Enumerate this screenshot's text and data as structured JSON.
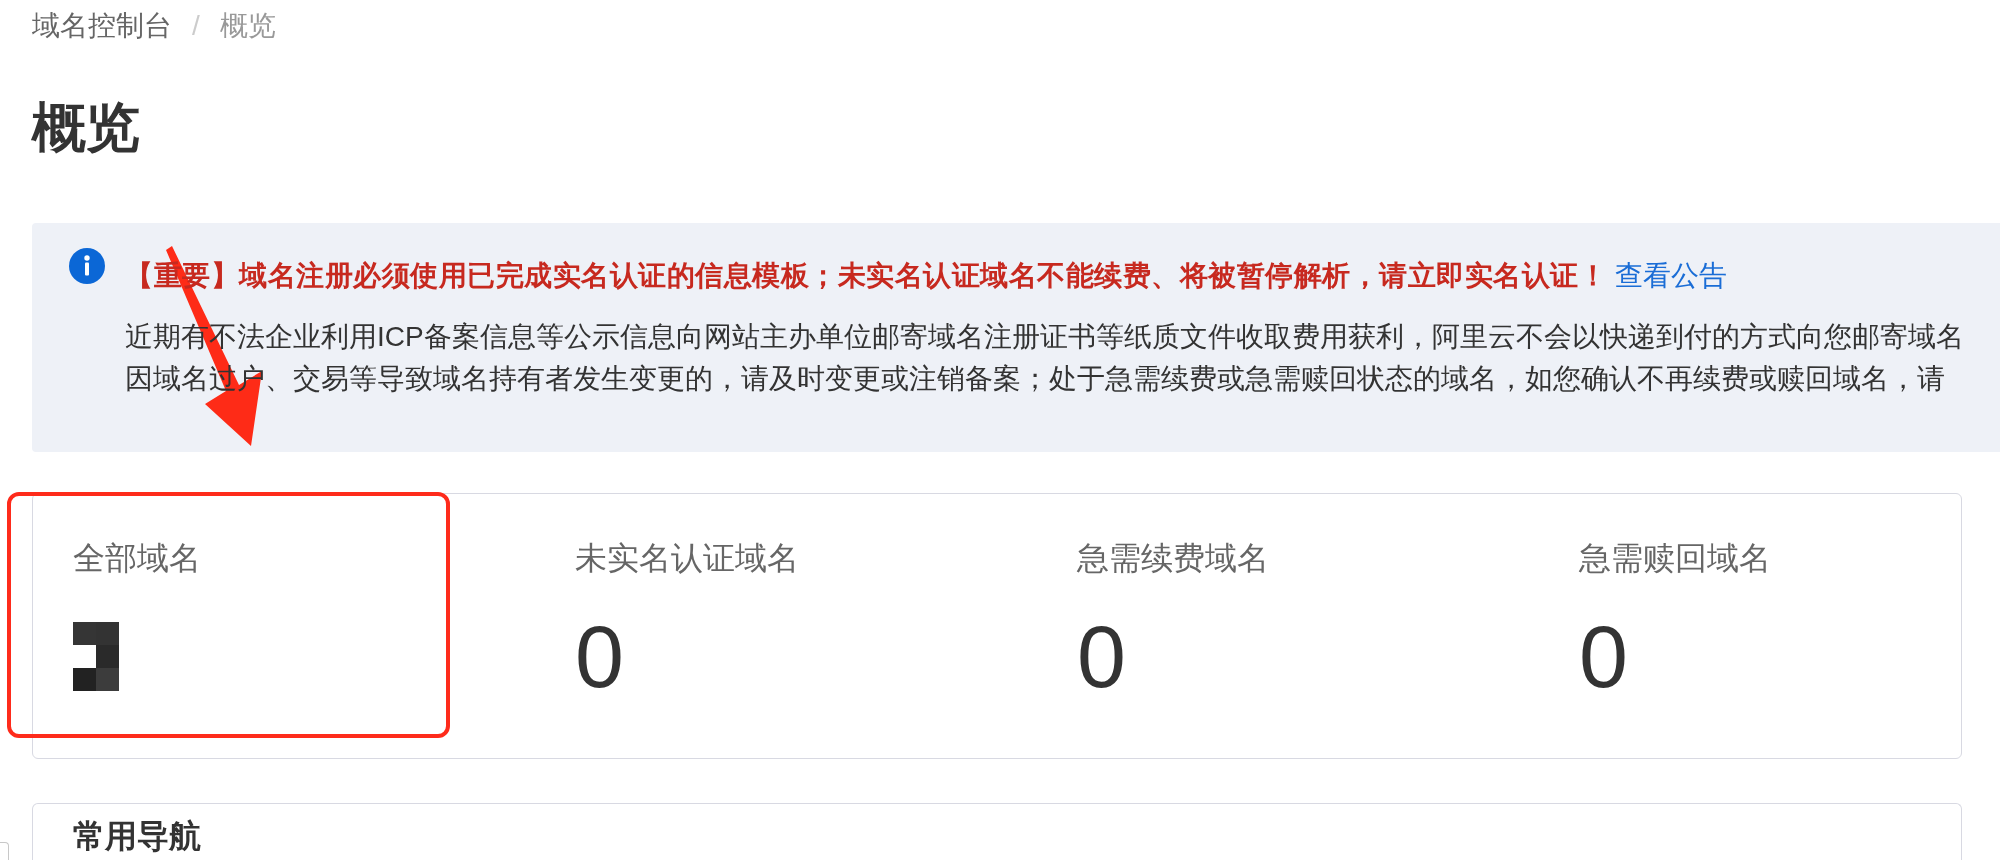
{
  "breadcrumb": {
    "separator": "/",
    "items": [
      {
        "label": "域名控制台",
        "current": false
      },
      {
        "label": "概览",
        "current": true
      }
    ]
  },
  "page_title": "概览",
  "notice": {
    "headline": "【重要】域名注册必须使用已完成实名认证的信息模板；未实名认证域名不能续费、将被暂停解析，请立即实名认证！",
    "link": "查看公告",
    "lines": [
      "近期有不法企业利用ICP备案信息等公示信息向网站主办单位邮寄域名注册证书等纸质文件收取费用获利，阿里云不会以快递到付的方式向您邮寄域名",
      "因域名过户、交易等导致域名持有者发生变更的，请及时变更或注销备案；处于急需续费或急需赎回状态的域名，如您确认不再续费或赎回域名，请"
    ]
  },
  "stats": [
    {
      "label": "全部域名",
      "redacted": true
    },
    {
      "label": "未实名认证域名",
      "value": "0",
      "redacted": false
    },
    {
      "label": "急需续费域名",
      "value": "0",
      "redacted": false
    },
    {
      "label": "急需赎回域名",
      "value": "0",
      "redacted": false
    }
  ],
  "nav_card": {
    "title": "常用导航"
  }
}
